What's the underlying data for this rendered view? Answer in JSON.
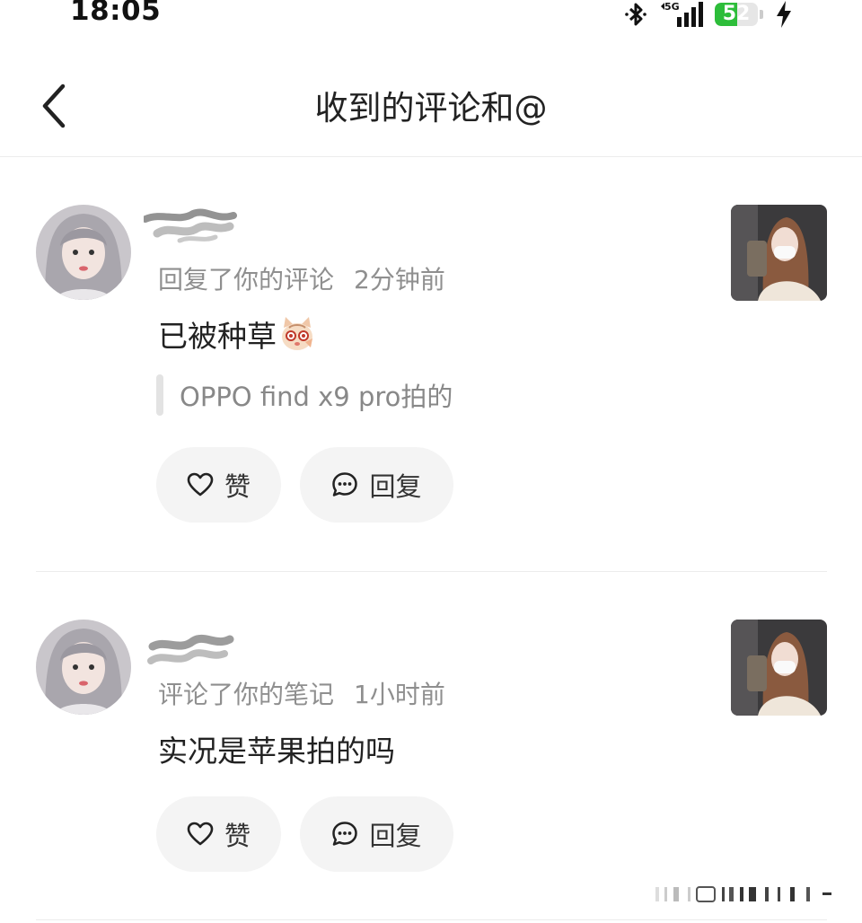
{
  "status_bar": {
    "time": "18:05",
    "network": "5G",
    "battery_level": "52",
    "battery_fraction": 0.52
  },
  "header": {
    "title": "收到的评论和@"
  },
  "notifications": [
    {
      "action": "回复了你的评论",
      "time": "2分钟前",
      "comment": "已被种草",
      "quoted": "OPPO find x9 pro拍的",
      "like_label": "赞",
      "reply_label": "回复"
    },
    {
      "action": "评论了你的笔记",
      "time": "1小时前",
      "comment": "实况是苹果拍的吗",
      "like_label": "赞",
      "reply_label": "回复"
    }
  ],
  "icons": {
    "back": "chevron-left-icon",
    "like": "heart-outline-icon",
    "reply": "chat-bubble-icon"
  },
  "colors": {
    "battery_green": "#2dbd3a",
    "meta_gray": "#8f8f8f",
    "pill_bg": "#f4f4f4"
  }
}
